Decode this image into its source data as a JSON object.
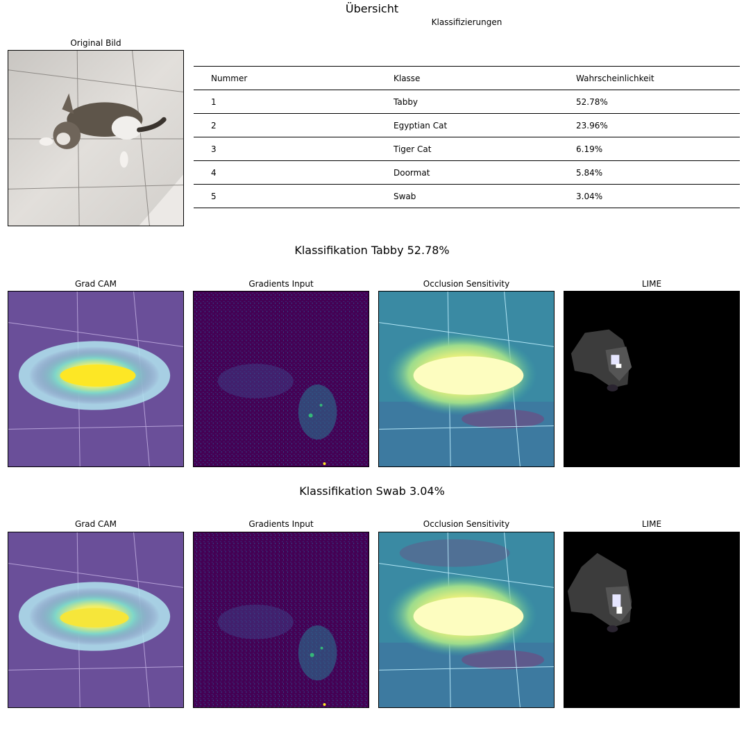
{
  "figure_title": "Übersicht",
  "original": {
    "title": "Original Bild"
  },
  "table": {
    "title": "Klassifizierungen",
    "headers": [
      "Nummer",
      "Klasse",
      "Wahrscheinlichkeit"
    ],
    "rows": [
      [
        "1",
        "Tabby",
        "52.78%"
      ],
      [
        "2",
        "Egyptian Cat",
        "23.96%"
      ],
      [
        "3",
        "Tiger Cat",
        "6.19%"
      ],
      [
        "4",
        "Doormat",
        "5.84%"
      ],
      [
        "5",
        "Swab",
        "3.04%"
      ]
    ]
  },
  "sections": [
    {
      "title": "Klassifikation Tabby 52.78%",
      "panels": [
        "Grad CAM",
        "Gradients Input",
        "Occlusion Sensitivity",
        "LIME"
      ]
    },
    {
      "title": "Klassifikation Swab 3.04%",
      "panels": [
        "Grad CAM",
        "Gradients Input",
        "Occlusion Sensitivity",
        "LIME"
      ]
    }
  ],
  "colors": {
    "viridis_dark": "#440154",
    "viridis_mid": "#21918c",
    "viridis_bright": "#fde725",
    "floor": "#d8d4d0",
    "lime_bg": "#000000"
  }
}
